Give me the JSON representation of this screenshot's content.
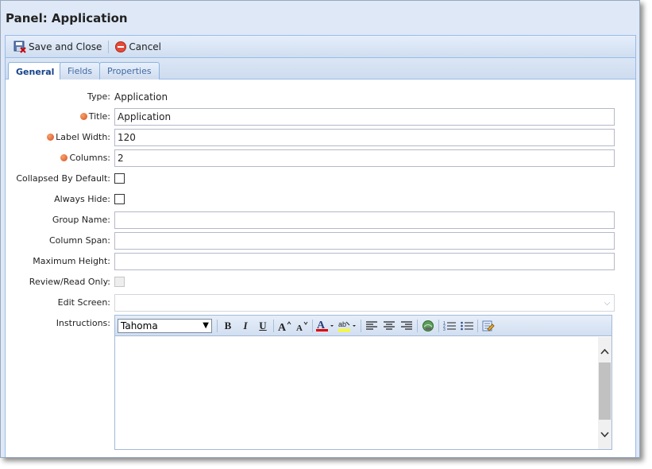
{
  "window": {
    "title": "Panel: Application"
  },
  "toolbar": {
    "save_close": "Save and Close",
    "cancel": "Cancel"
  },
  "tabs": [
    {
      "label": "General",
      "active": true
    },
    {
      "label": "Fields",
      "active": false
    },
    {
      "label": "Properties",
      "active": false
    }
  ],
  "form": {
    "type_label": "Type:",
    "type_value": "Application",
    "title_label": "Title:",
    "title_value": "Application",
    "label_width_label": "Label Width:",
    "label_width_value": "120",
    "columns_label": "Columns:",
    "columns_value": "2",
    "collapsed_label": "Collapsed By Default:",
    "collapsed_checked": false,
    "always_hide_label": "Always Hide:",
    "always_hide_checked": false,
    "group_name_label": "Group Name:",
    "group_name_value": "",
    "column_span_label": "Column Span:",
    "column_span_value": "",
    "max_height_label": "Maximum Height:",
    "max_height_value": "",
    "review_label": "Review/Read Only:",
    "review_checked": false,
    "edit_screen_label": "Edit Screen:",
    "edit_screen_value": "",
    "instructions_label": "Instructions:",
    "font": "Tahoma"
  },
  "colors": {
    "required": "#e0622a",
    "tab_active": "#15428b",
    "tab_text": "#416aa3"
  }
}
